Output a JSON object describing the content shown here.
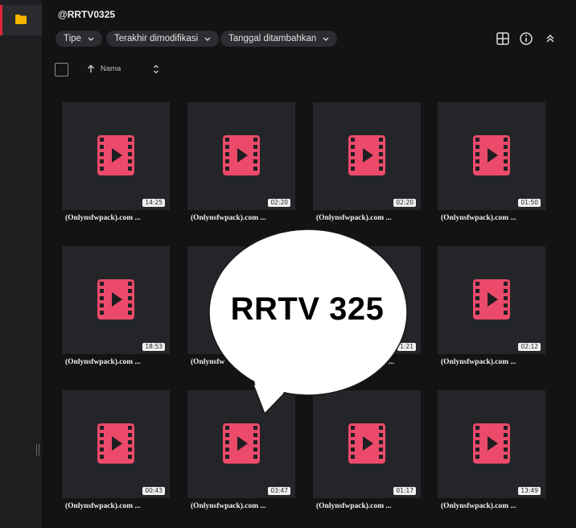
{
  "title": "@RRTV0325",
  "filters": [
    "Tipe",
    "Terakhir dimodifikasi",
    "Tanggal ditambahkan"
  ],
  "sort": {
    "label": "Nama"
  },
  "icons": {
    "folder": "folder-icon",
    "grid": "grid-view-icon",
    "info": "info-icon",
    "collapse": "collapse-icon"
  },
  "colors": {
    "accent": "#e0263d",
    "video_icon": "#ec4a6a",
    "folder": "#f4b400"
  },
  "files": [
    {
      "name": "(Onlynsfwpack).com ...",
      "duration": "14:25"
    },
    {
      "name": "(Onlynsfwpack).com ...",
      "duration": "02:20"
    },
    {
      "name": "(Onlynsfwpack).com ...",
      "duration": "02:20"
    },
    {
      "name": "(Onlynsfwpack).com ...",
      "duration": "01:50"
    },
    {
      "name": "(Onlynsfwpack).com ...",
      "duration": "18:53"
    },
    {
      "name": "(Onlynsfw",
      "duration": ""
    },
    {
      "name": "...",
      "duration": "1:21"
    },
    {
      "name": "(Onlynsfwpack).com ...",
      "duration": "02:12"
    },
    {
      "name": "(Onlynsfwpack).com ...",
      "duration": "00:43"
    },
    {
      "name": "(Onlynsfwpack).com ...",
      "duration": "03:47"
    },
    {
      "name": "(Onlynsfwpack).com ...",
      "duration": "01:17"
    },
    {
      "name": "(Onlynsfwpack).com ...",
      "duration": "13:49"
    }
  ],
  "overlay": {
    "text": "RRTV 325"
  }
}
